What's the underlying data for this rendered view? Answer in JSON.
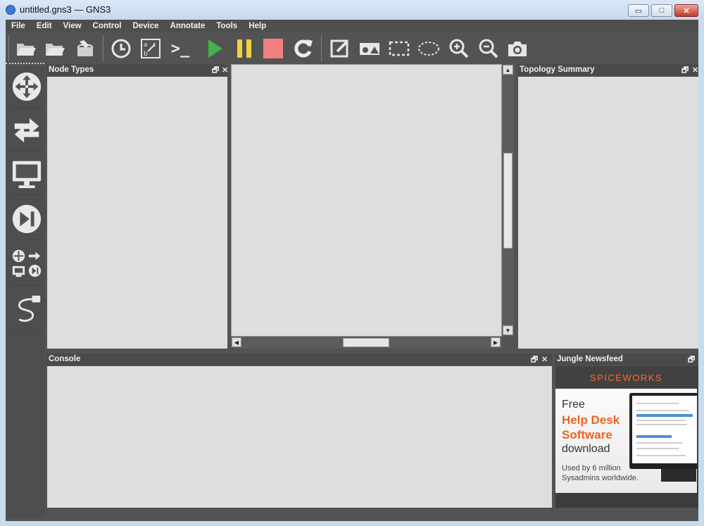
{
  "window": {
    "title": "untitled.gns3 — GNS3",
    "controls": {
      "minimize": "▭",
      "maximize": "□",
      "close": "✕"
    }
  },
  "menu": [
    "File",
    "Edit",
    "View",
    "Control",
    "Device",
    "Annotate",
    "Tools",
    "Help"
  ],
  "toolbar": {
    "buttons": [
      "open-project-icon",
      "open-folder-icon",
      "save-snapshot-icon",
      "clock-icon",
      "show-interface-labels-icon",
      "console-all-icon",
      "start-all-icon",
      "suspend-all-icon",
      "stop-all-icon",
      "reload-all-icon",
      "add-note-icon",
      "insert-picture-icon",
      "draw-rectangle-icon",
      "draw-ellipse-icon",
      "zoom-in-icon",
      "zoom-out-icon",
      "screenshot-icon"
    ],
    "console_glyph": ">_"
  },
  "colors": {
    "background": "#535353",
    "panel_body": "#dedede",
    "start": "#44b24a",
    "suspend": "#f2d33c",
    "stop": "#f27f7f",
    "spiceworks": "#ee6320"
  },
  "devices": [
    "router-icon",
    "switch-icon",
    "end-device-icon",
    "security-device-icon",
    "all-devices-icon",
    "add-link-icon"
  ],
  "panels": {
    "node_types": {
      "title": "Node Types"
    },
    "topology_summary": {
      "title": "Topology Summary"
    },
    "console": {
      "title": "Console"
    },
    "newsfeed": {
      "title": "Jungle Newsfeed"
    },
    "float_glyph": "🗗",
    "close_glyph": "✕"
  },
  "ad": {
    "brand": "SPICEWORKS",
    "line1": "Free",
    "line2": "Help Desk",
    "line3": "Software",
    "line4": "download",
    "line5": "Used by 6 million",
    "line6": "Sysadmins worldwide."
  }
}
